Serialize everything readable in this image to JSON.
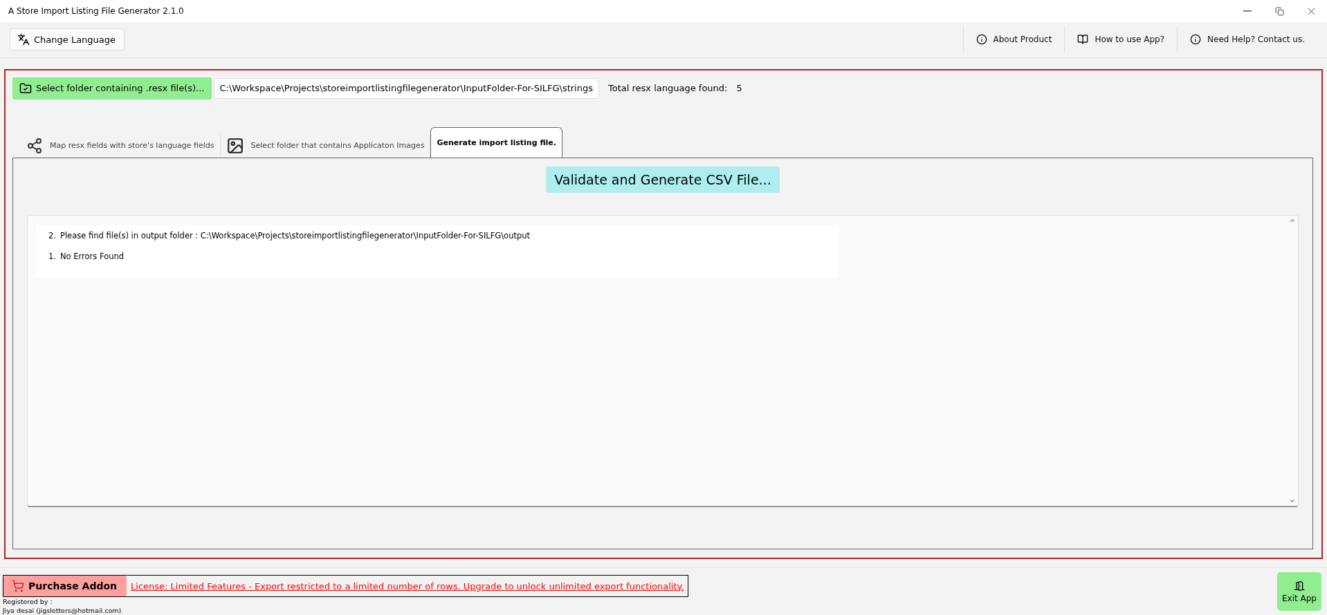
{
  "window": {
    "title": "A Store Import Listing File Generator 2.1.0"
  },
  "toolbar": {
    "language_button": "Change Language",
    "links": [
      {
        "kind": "info",
        "label": "About Product"
      },
      {
        "kind": "book",
        "label": "How to use App?"
      },
      {
        "kind": "info",
        "label": "Need Help? Contact us."
      }
    ]
  },
  "folder": {
    "button": "Select folder containing .resx file(s)...",
    "path": "C:\\Workspace\\Projects\\storeimportlistingfilegenerator\\InputFolder-For-SILFG\\strings",
    "count_label": "Total resx language found:",
    "count": "5"
  },
  "tabs": [
    {
      "kind": "share",
      "label": "Map resx fields with store's language fields",
      "selected": false
    },
    {
      "kind": "image",
      "label": "Select folder that contains Applicaton Images",
      "selected": false
    },
    {
      "kind": "none",
      "label": "Generate import listing file.",
      "selected": true
    }
  ],
  "generate_button": "Validate and Generate CSV File...",
  "log": [
    {
      "number": "2.",
      "text": "Please find file(s) in output folder : C:\\Workspace\\Projects\\storeimportlistingfilegenerator\\InputFolder-For-SILFG\\output"
    },
    {
      "number": "1.",
      "text": "No Errors Found"
    }
  ],
  "footer": {
    "purchase_button": "Purchase Addon",
    "license": "License: Limited Features - Export restricted to a limited number of rows. Upgrade to unlock unlimited export functionality.",
    "registered_label": "Registered by :",
    "registered_user": "Jiya desai (jigsletters@hotmail.com)",
    "exit_button": "Exit App"
  }
}
